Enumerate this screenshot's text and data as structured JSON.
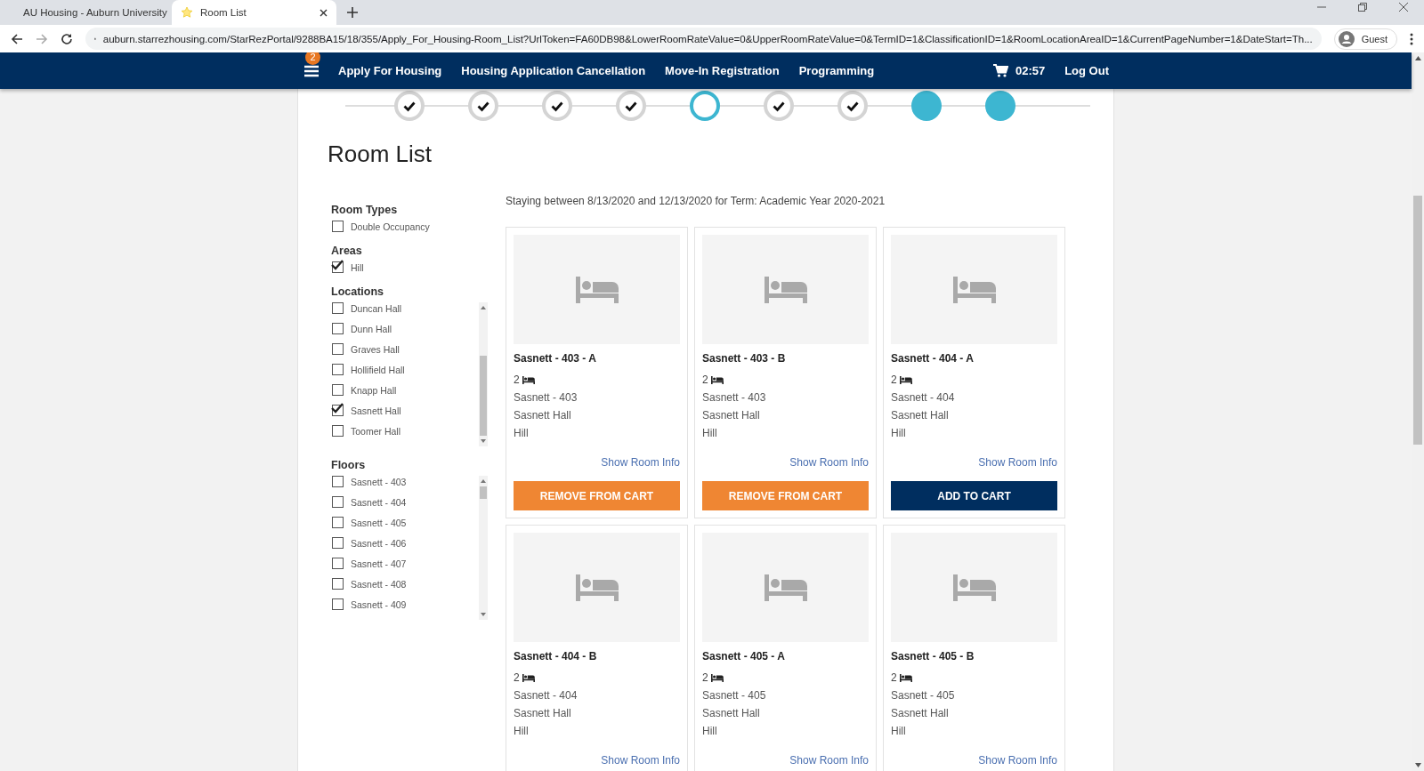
{
  "browser": {
    "tabs": [
      {
        "title": "AU Housing - Auburn University",
        "selected": false
      },
      {
        "title": "Room List",
        "selected": true
      }
    ],
    "url": "auburn.starrezhousing.com/StarRezPortal/9288BA15/18/355/Apply_For_Housing-Room_List?UrlToken=FA60DB98&LowerRoomRateValue=0&UpperRoomRateValue=0&TermID=1&ClassificationID=1&RoomLocationAreaID=1&CurrentPageNumber=1&DateStart=Th...",
    "profile": "Guest"
  },
  "nav": {
    "badge": "2",
    "links": [
      "Apply For Housing",
      "Housing Application Cancellation",
      "Move-In Registration",
      "Programming"
    ],
    "timer": "02:57",
    "logout": "Log Out"
  },
  "steps": [
    {
      "completed": true,
      "current": false
    },
    {
      "completed": true,
      "current": false
    },
    {
      "completed": true,
      "current": false
    },
    {
      "completed": true,
      "current": false
    },
    {
      "completed": false,
      "current": true
    },
    {
      "completed": true,
      "current": false
    },
    {
      "completed": true,
      "current": false
    },
    {
      "completed": false,
      "current": false
    },
    {
      "completed": false,
      "current": false
    }
  ],
  "page_title": "Room List",
  "filters": [
    {
      "heading": "Room Types",
      "scrollable": false,
      "options": [
        {
          "label": "Double Occupancy",
          "checked": false
        }
      ]
    },
    {
      "heading": "Areas",
      "scrollable": false,
      "options": [
        {
          "label": "Hill",
          "checked": true
        }
      ]
    },
    {
      "heading": "Locations",
      "scrollable": true,
      "options": [
        {
          "label": "Duncan Hall",
          "checked": false
        },
        {
          "label": "Dunn Hall",
          "checked": false
        },
        {
          "label": "Graves Hall",
          "checked": false
        },
        {
          "label": "Hollifield Hall",
          "checked": false
        },
        {
          "label": "Knapp Hall",
          "checked": false
        },
        {
          "label": "Sasnett Hall",
          "checked": true
        },
        {
          "label": "Toomer Hall",
          "checked": false
        }
      ]
    },
    {
      "heading": "Floors",
      "scrollable": true,
      "options": [
        {
          "label": "Sasnett - 403",
          "checked": false
        },
        {
          "label": "Sasnett - 404",
          "checked": false
        },
        {
          "label": "Sasnett - 405",
          "checked": false
        },
        {
          "label": "Sasnett - 406",
          "checked": false
        },
        {
          "label": "Sasnett - 407",
          "checked": false
        },
        {
          "label": "Sasnett - 408",
          "checked": false
        },
        {
          "label": "Sasnett - 409",
          "checked": false
        }
      ]
    }
  ],
  "stay_text": "Staying between 8/13/2020 and 12/13/2020 for Term: Academic Year 2020-2021",
  "rooms": [
    {
      "name": "Sasnett - 403 - A",
      "beds": "2",
      "floor": "Sasnett - 403",
      "hall": "Sasnett Hall",
      "area": "Hill",
      "info_link": "Show Room Info",
      "action": {
        "label": "REMOVE FROM CART",
        "in_cart": true
      }
    },
    {
      "name": "Sasnett - 403 - B",
      "beds": "2",
      "floor": "Sasnett - 403",
      "hall": "Sasnett Hall",
      "area": "Hill",
      "info_link": "Show Room Info",
      "action": {
        "label": "REMOVE FROM CART",
        "in_cart": true
      }
    },
    {
      "name": "Sasnett - 404 - A",
      "beds": "2",
      "floor": "Sasnett - 404",
      "hall": "Sasnett Hall",
      "area": "Hill",
      "info_link": "Show Room Info",
      "action": {
        "label": "ADD TO CART",
        "in_cart": false
      }
    },
    {
      "name": "Sasnett - 404 - B",
      "beds": "2",
      "floor": "Sasnett - 404",
      "hall": "Sasnett Hall",
      "area": "Hill",
      "info_link": "Show Room Info"
    },
    {
      "name": "Sasnett - 405 - A",
      "beds": "2",
      "floor": "Sasnett - 405",
      "hall": "Sasnett Hall",
      "area": "Hill",
      "info_link": "Show Room Info"
    },
    {
      "name": "Sasnett - 405 - B",
      "beds": "2",
      "floor": "Sasnett - 405",
      "hall": "Sasnett Hall",
      "area": "Hill",
      "info_link": "Show Room Info"
    }
  ]
}
